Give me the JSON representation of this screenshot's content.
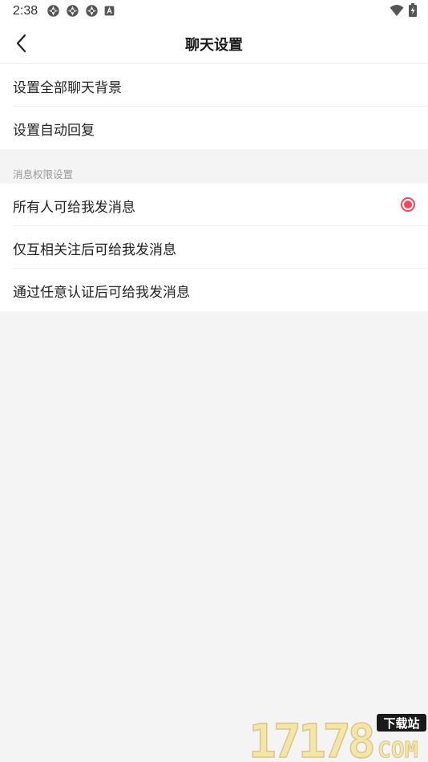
{
  "status_bar": {
    "time": "2:38",
    "icons": [
      "notification-app-icon",
      "notification-app-icon",
      "notification-app-icon",
      "a-notification-icon"
    ],
    "right_icons": [
      "wifi-icon",
      "battery-charging-icon"
    ]
  },
  "nav": {
    "title": "聊天设置",
    "back_icon": "chevron-left-icon"
  },
  "group_1": {
    "items": [
      {
        "label": "设置全部聊天背景"
      },
      {
        "label": "设置自动回复"
      }
    ]
  },
  "permissions": {
    "header": "消息权限设置",
    "items": [
      {
        "label": "所有人可给我发消息",
        "selected": true
      },
      {
        "label": "仅互相关注后可给我发消息",
        "selected": false
      },
      {
        "label": "通过任意认证后可给我发消息",
        "selected": false
      }
    ]
  },
  "watermark": {
    "digits": "17178",
    "site": "下载站",
    "domain": "COM"
  },
  "colors": {
    "accent": "#f5465d",
    "background": "#f4f4f4",
    "surface": "#ffffff",
    "divider": "#ececec"
  }
}
